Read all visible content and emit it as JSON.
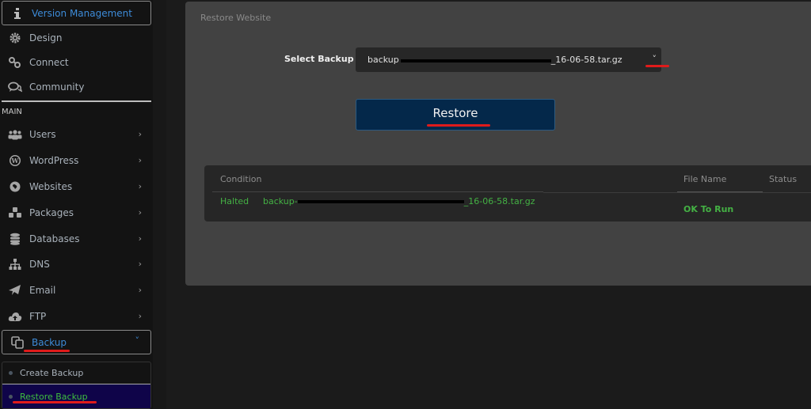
{
  "sidebar": {
    "top_items": [
      {
        "label": "Version Management",
        "icon": "info-icon"
      },
      {
        "label": "Design",
        "icon": "gear-icon"
      },
      {
        "label": "Connect",
        "icon": "link-icon"
      },
      {
        "label": "Community",
        "icon": "comments-icon"
      }
    ],
    "section_label": "MAIN",
    "main_items": [
      {
        "label": "Users",
        "icon": "users-icon"
      },
      {
        "label": "WordPress",
        "icon": "wordpress-icon"
      },
      {
        "label": "Websites",
        "icon": "globe-icon"
      },
      {
        "label": "Packages",
        "icon": "cubes-icon"
      },
      {
        "label": "Databases",
        "icon": "database-icon"
      },
      {
        "label": "DNS",
        "icon": "sitemap-icon"
      },
      {
        "label": "Email",
        "icon": "paper-plane-icon"
      },
      {
        "label": "FTP",
        "icon": "cloud-upload-icon"
      },
      {
        "label": "Backup",
        "icon": "copy-icon"
      }
    ],
    "backup_submenu": [
      {
        "label": "Create Backup"
      },
      {
        "label": "Restore Backup"
      }
    ],
    "chevron_right": "›",
    "chevron_down": "˅"
  },
  "main": {
    "card_title": "Restore Website",
    "select_label": "Select Backup",
    "select_value_prefix": "backup",
    "select_value_suffix": "_16-06-58.tar.gz",
    "restore_button": "Restore",
    "table": {
      "headers": [
        "Condition",
        "File Name",
        "Status"
      ],
      "row": {
        "condition": "Halted",
        "file_prefix": "backup-",
        "file_suffix": "_16-06-58.tar.gz",
        "status": "OK To Run"
      }
    }
  },
  "colors": {
    "accent_blue": "#3d8bd8",
    "success_green": "#44b144",
    "active_submenu_bg": "#0f0449",
    "button_bg": "#04284a",
    "annotation_red": "#e01b1b"
  }
}
